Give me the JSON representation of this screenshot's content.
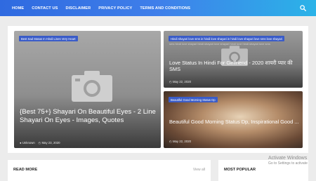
{
  "nav": {
    "items": [
      "HOME",
      "CONTACT US",
      "DISCLAIMER",
      "PRIVACY POLICY",
      "TERMS AND CONDITIONS"
    ],
    "search_icon": "search-icon"
  },
  "featured": {
    "big": {
      "badge": "Best Sad Status In Hindi Lines Very Heart",
      "title": "{Best 75+} Shayari On Beautiful Eyes - 2 Line Shayari On Eyes - Images, Quotes",
      "author": "Unknown",
      "date": "May 23, 2020"
    },
    "top": {
      "badge": "Hindi shayari love sms in hindi love shayari in hindi love shayari love sms love shayari",
      "overlay_text": "sms hindi love shayari hindi shayari love shayari hindi love hindi shayari love sms",
      "title": "Love Status In Hindi For Girlfriend - 2020 शायरी प्यार की SMS",
      "date": "May 22, 2020"
    },
    "bottom": {
      "badge": "Beautiful Good Morning Status Dp",
      "title": "Beautiful Good Morning Status Dp, Inspirational Good ...",
      "date": "May 22, 2020"
    }
  },
  "read_more": {
    "title": "READ MORE",
    "view_all": "View all"
  },
  "most_popular": {
    "title": "MOST POPULAR"
  },
  "watermark": {
    "line1": "Activate Windows",
    "line2": "Go to Settings to activate"
  }
}
